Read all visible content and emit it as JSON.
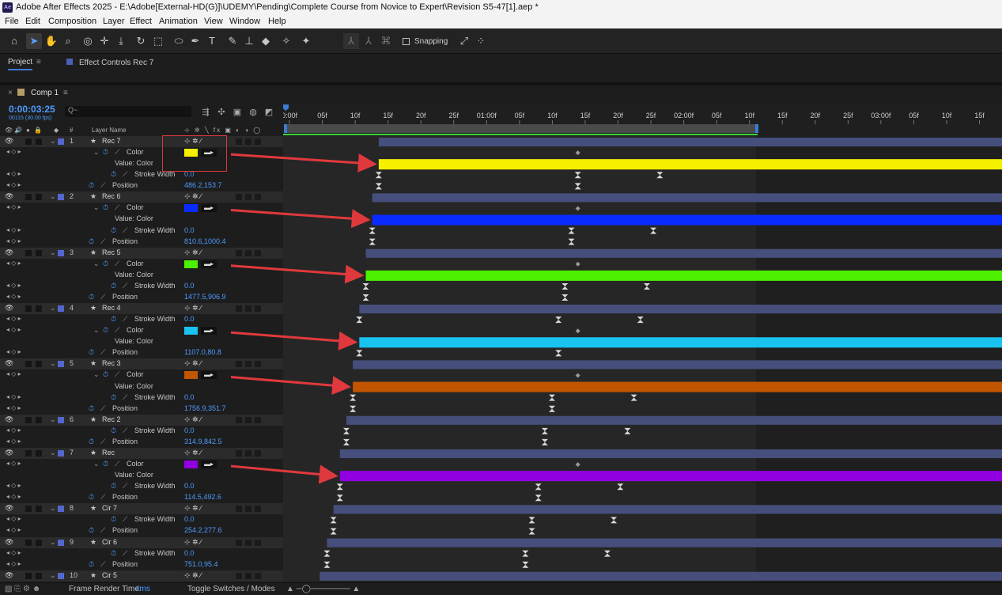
{
  "window": {
    "title": "Adobe After Effects 2025 - E:\\Adobe[External-HD(G)]\\UDEMY\\Pending\\Complete Course from Novice to Expert\\Revision S5-47[1].aep *"
  },
  "menu": [
    "File",
    "Edit",
    "Composition",
    "Layer",
    "Effect",
    "Animation",
    "View",
    "Window",
    "Help"
  ],
  "toolbar": {
    "snapping_label": "Snapping"
  },
  "panels": {
    "project_tab": "Project",
    "effect_controls_tab": "Effect Controls Rec 7"
  },
  "comp": {
    "tab": "Comp 1",
    "timecode": "0:00:03:25",
    "fps_info": "00115 (30.00 fps)",
    "search_placeholder": "Q~"
  },
  "columns": {
    "number": "#",
    "layer_name": "Layer Name"
  },
  "ruler_labels": [
    "0:00f",
    "05f",
    "10f",
    "15f",
    "20f",
    "25f",
    "01:00f",
    "05f",
    "10f",
    "15f",
    "20f",
    "25f",
    "02:00f",
    "05f",
    "10f",
    "15f",
    "20f",
    "25f",
    "03:00f",
    "05f",
    "10f",
    "15f"
  ],
  "rows": [
    {
      "kind": "layer",
      "num": "1",
      "name": "Rec 7",
      "start": 0.133
    },
    {
      "kind": "prop",
      "name": "Color",
      "chip": "#f6f000",
      "twirl": true,
      "start": 0.133,
      "kfs": [
        0.41
      ]
    },
    {
      "kind": "value",
      "name": "Value: Color",
      "bar": "#f6f000",
      "start": 0.133
    },
    {
      "kind": "prop",
      "name": "Stroke Width",
      "value": "0.0",
      "indent": 2,
      "start": 0.133,
      "kfs": [
        0.133,
        0.41,
        0.524
      ]
    },
    {
      "kind": "prop",
      "name": "Position",
      "value": "486.2,153.7",
      "indent": 1,
      "start": 0.133,
      "kfs": [
        0.133,
        0.41
      ]
    },
    {
      "kind": "layer",
      "num": "2",
      "name": "Rec 6",
      "start": 0.124
    },
    {
      "kind": "prop",
      "name": "Color",
      "chip": "#0a2bff",
      "twirl": true,
      "start": 0.124,
      "kfs": [
        0.41
      ]
    },
    {
      "kind": "value",
      "name": "Value: Color",
      "bar": "#0a2bff",
      "start": 0.124
    },
    {
      "kind": "prop",
      "name": "Stroke Width",
      "value": "0.0",
      "indent": 2,
      "start": 0.124,
      "kfs": [
        0.124,
        0.401,
        0.515
      ]
    },
    {
      "kind": "prop",
      "name": "Position",
      "value": "810.6,1000.4",
      "indent": 1,
      "start": 0.124,
      "kfs": [
        0.124,
        0.401
      ]
    },
    {
      "kind": "layer",
      "num": "3",
      "name": "Rec 5",
      "start": 0.115
    },
    {
      "kind": "prop",
      "name": "Color",
      "chip": "#4cf000",
      "twirl": true,
      "start": 0.115,
      "kfs": [
        0.41
      ]
    },
    {
      "kind": "value",
      "name": "Value: Color",
      "bar": "#4cf000",
      "start": 0.115
    },
    {
      "kind": "prop",
      "name": "Stroke Width",
      "value": "0.0",
      "indent": 2,
      "start": 0.115,
      "kfs": [
        0.115,
        0.392,
        0.506
      ]
    },
    {
      "kind": "prop",
      "name": "Position",
      "value": "1477.5,906.9",
      "indent": 1,
      "start": 0.115,
      "kfs": [
        0.115,
        0.392
      ]
    },
    {
      "kind": "layer",
      "num": "4",
      "name": "Rec 4",
      "start": 0.106
    },
    {
      "kind": "prop",
      "name": "Stroke Width",
      "value": "0.0",
      "indent": 2,
      "start": 0.106,
      "kfs": [
        0.106,
        0.383,
        0.497
      ]
    },
    {
      "kind": "prop",
      "name": "Color",
      "chip": "#19c3f0",
      "twirl": true,
      "start": 0.106,
      "kfs": [
        0.41
      ]
    },
    {
      "kind": "value",
      "name": "Value: Color",
      "bar": "#19c3f0",
      "start": 0.106
    },
    {
      "kind": "prop",
      "name": "Position",
      "value": "1107.0,80.8",
      "indent": 1,
      "start": 0.106,
      "kfs": [
        0.106,
        0.383
      ]
    },
    {
      "kind": "layer",
      "num": "5",
      "name": "Rec 3",
      "start": 0.097
    },
    {
      "kind": "prop",
      "name": "Color",
      "chip": "#c25500",
      "twirl": true,
      "start": 0.097,
      "kfs": [
        0.41
      ]
    },
    {
      "kind": "value",
      "name": "Value: Color",
      "bar": "#c25500",
      "start": 0.097
    },
    {
      "kind": "prop",
      "name": "Stroke Width",
      "value": "0.0",
      "indent": 2,
      "start": 0.097,
      "kfs": [
        0.097,
        0.374,
        0.488
      ]
    },
    {
      "kind": "prop",
      "name": "Position",
      "value": "1756.9,351.7",
      "indent": 1,
      "start": 0.097,
      "kfs": [
        0.097,
        0.374
      ]
    },
    {
      "kind": "layer",
      "num": "6",
      "name": "Rec 2",
      "start": 0.088
    },
    {
      "kind": "prop",
      "name": "Stroke Width",
      "value": "0.0",
      "indent": 2,
      "start": 0.088,
      "kfs": [
        0.088,
        0.364,
        0.479
      ]
    },
    {
      "kind": "prop",
      "name": "Position",
      "value": "314.9,842.5",
      "indent": 1,
      "start": 0.088,
      "kfs": [
        0.088,
        0.364
      ]
    },
    {
      "kind": "layer",
      "num": "7",
      "name": "Rec",
      "start": 0.079
    },
    {
      "kind": "prop",
      "name": "Color",
      "chip": "#9000e0",
      "twirl": true,
      "start": 0.079,
      "kfs": [
        0.41
      ]
    },
    {
      "kind": "value",
      "name": "Value: Color",
      "bar": "#9000e0",
      "start": 0.079
    },
    {
      "kind": "prop",
      "name": "Stroke Width",
      "value": "0.0",
      "indent": 2,
      "start": 0.079,
      "kfs": [
        0.079,
        0.355,
        0.469
      ]
    },
    {
      "kind": "prop",
      "name": "Position",
      "value": "114.5,492.6",
      "indent": 1,
      "start": 0.079,
      "kfs": [
        0.079,
        0.355
      ]
    },
    {
      "kind": "layer",
      "num": "8",
      "name": "Cir 7",
      "start": 0.07
    },
    {
      "kind": "prop",
      "name": "Stroke Width",
      "value": "0.0",
      "indent": 2,
      "start": 0.07,
      "kfs": [
        0.07,
        0.346,
        0.46
      ]
    },
    {
      "kind": "prop",
      "name": "Position",
      "value": "254.2,277.6",
      "indent": 1,
      "start": 0.07,
      "kfs": [
        0.07,
        0.346
      ]
    },
    {
      "kind": "layer",
      "num": "9",
      "name": "Cir 6",
      "start": 0.061
    },
    {
      "kind": "prop",
      "name": "Stroke Width",
      "value": "0.0",
      "indent": 2,
      "start": 0.061,
      "kfs": [
        0.061,
        0.337,
        0.451
      ]
    },
    {
      "kind": "prop",
      "name": "Position",
      "value": "751.0,95.4",
      "indent": 1,
      "start": 0.061,
      "kfs": [
        0.061,
        0.337
      ]
    },
    {
      "kind": "layer",
      "num": "10",
      "name": "Cir 5",
      "start": 0.051
    }
  ],
  "status": {
    "render_label": "Frame Render Time:",
    "render_value": "4ms",
    "toggle": "Toggle Switches / Modes"
  }
}
